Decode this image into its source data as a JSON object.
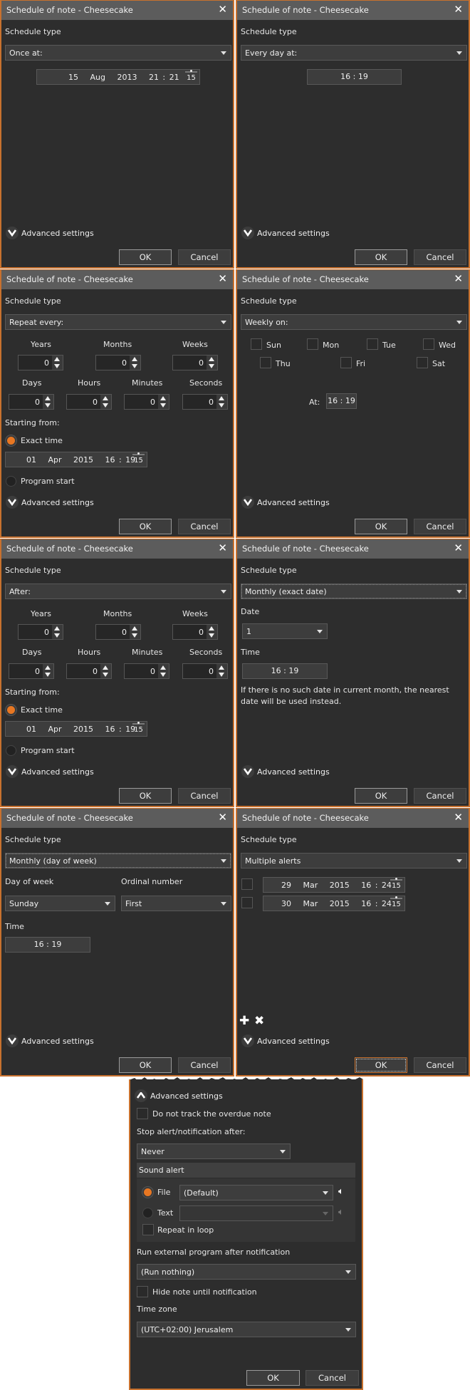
{
  "common": {
    "window_title": "Schedule of note - Cheesecake",
    "close_glyph": "✕",
    "schedule_type_label": "Schedule type",
    "advanced_settings_label": "Advanced settings",
    "ok_label": "OK",
    "cancel_label": "Cancel",
    "calendar_day": "15",
    "accent_color": "#e87722"
  },
  "dialogs": [
    {
      "schedule_type": "Once at:",
      "datetime": "15   Aug   2013   21 : 21"
    },
    {
      "schedule_type": "Every day at:",
      "time": "16 : 19"
    },
    {
      "schedule_type": "Repeat every:",
      "units_row1": [
        {
          "label": "Years",
          "value": "0"
        },
        {
          "label": "Months",
          "value": "0"
        },
        {
          "label": "Weeks",
          "value": "0"
        }
      ],
      "units_row2": [
        {
          "label": "Days",
          "value": "0"
        },
        {
          "label": "Hours",
          "value": "0"
        },
        {
          "label": "Minutes",
          "value": "0"
        },
        {
          "label": "Seconds",
          "value": "0"
        }
      ],
      "starting_from_label": "Starting from:",
      "exact_time_label": "Exact time",
      "exact_time_selected": true,
      "datetime": "01   Apr   2015   16 : 19",
      "program_start_label": "Program start"
    },
    {
      "schedule_type": "Weekly on:",
      "days": [
        {
          "label": "Sun",
          "checked": false
        },
        {
          "label": "Mon",
          "checked": false
        },
        {
          "label": "Tue",
          "checked": false
        },
        {
          "label": "Wed",
          "checked": false
        },
        {
          "label": "Thu",
          "checked": false
        },
        {
          "label": "Fri",
          "checked": false
        },
        {
          "label": "Sat",
          "checked": false
        }
      ],
      "at_label": "At:",
      "time": "16 : 19"
    },
    {
      "schedule_type": "After:",
      "units_row1": [
        {
          "label": "Years",
          "value": "0"
        },
        {
          "label": "Months",
          "value": "0"
        },
        {
          "label": "Weeks",
          "value": "0"
        }
      ],
      "units_row2": [
        {
          "label": "Days",
          "value": "0"
        },
        {
          "label": "Hours",
          "value": "0"
        },
        {
          "label": "Minutes",
          "value": "0"
        },
        {
          "label": "Seconds",
          "value": "0"
        }
      ],
      "starting_from_label": "Starting from:",
      "exact_time_label": "Exact time",
      "exact_time_selected": true,
      "datetime": "01   Apr   2015   16 : 19",
      "program_start_label": "Program start"
    },
    {
      "schedule_type": "Monthly (exact date)",
      "date_label": "Date",
      "date_value": "1",
      "time_label": "Time",
      "time": "16 : 19",
      "note": "If there is no such date in current month, the nearest date will be used instead."
    },
    {
      "schedule_type": "Monthly (day of week)",
      "day_of_week_label": "Day of week",
      "day_of_week_value": "Sunday",
      "ordinal_label": "Ordinal number",
      "ordinal_value": "First",
      "time_label": "Time",
      "time": "16 : 19"
    },
    {
      "schedule_type": "Multiple alerts",
      "alerts": [
        {
          "checked": false,
          "datetime": "29   Mar   2015   16 : 24"
        },
        {
          "checked": false,
          "datetime": "30   Mar   2015   16 : 24"
        }
      ],
      "add_glyph": "✚",
      "remove_glyph": "✖"
    }
  ],
  "advanced": {
    "header": "Advanced settings",
    "do_not_track_label": "Do not track the overdue note",
    "do_not_track_checked": false,
    "stop_after_label": "Stop alert/notification after:",
    "stop_after_value": "Never",
    "sound_alert_label": "Sound alert",
    "file_label": "File",
    "file_selected": true,
    "file_value": "(Default)",
    "text_label": "Text",
    "text_value": "",
    "repeat_loop_label": "Repeat in loop",
    "repeat_loop_checked": false,
    "run_program_label": "Run external program after notification",
    "run_program_value": "(Run nothing)",
    "hide_note_label": "Hide note until notification",
    "hide_note_checked": false,
    "time_zone_label": "Time zone",
    "time_zone_value": "(UTC+02:00) Jerusalem",
    "ok_label": "OK",
    "cancel_label": "Cancel"
  }
}
